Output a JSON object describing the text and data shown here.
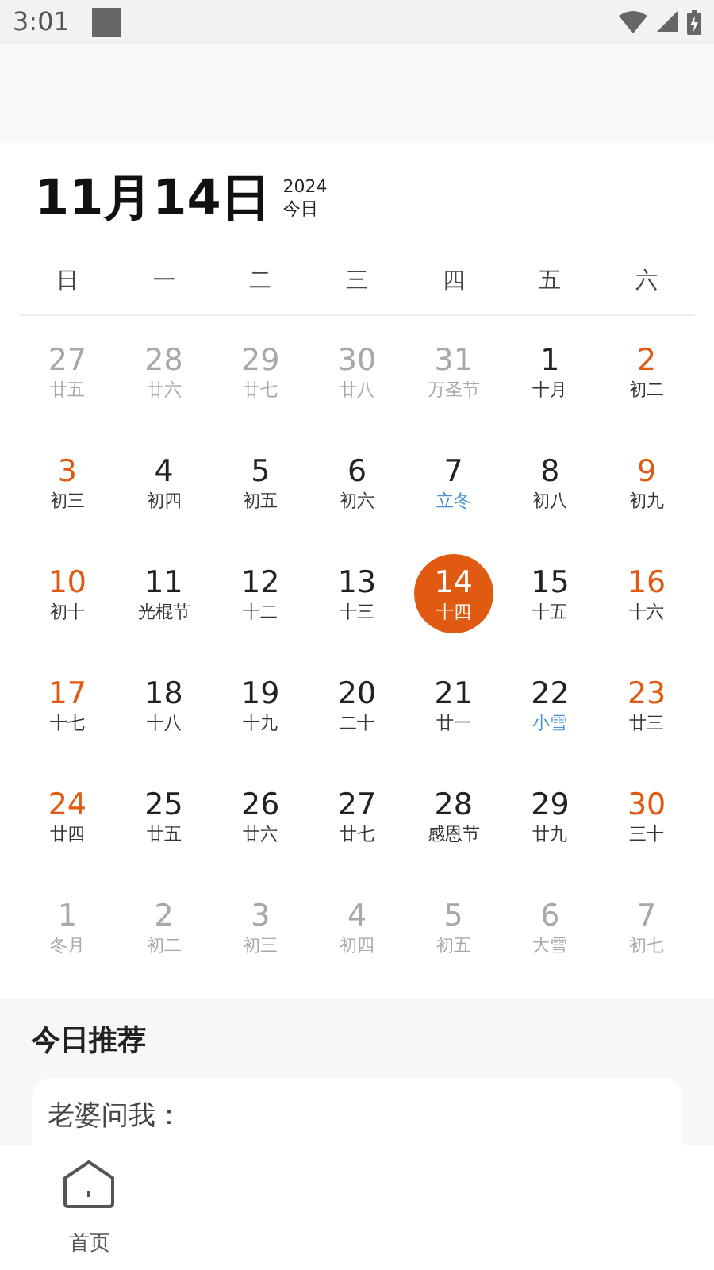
{
  "status_bar": {
    "time": "3:01"
  },
  "header": {
    "date": "11月14日",
    "year": "2024",
    "today": "今日"
  },
  "weekdays": [
    "日",
    "一",
    "二",
    "三",
    "四",
    "五",
    "六"
  ],
  "weeks": [
    [
      {
        "day": "27",
        "lunar": "廿五",
        "in_month": false,
        "term": false,
        "selected": false
      },
      {
        "day": "28",
        "lunar": "廿六",
        "in_month": false,
        "term": false,
        "selected": false
      },
      {
        "day": "29",
        "lunar": "廿七",
        "in_month": false,
        "term": false,
        "selected": false
      },
      {
        "day": "30",
        "lunar": "廿八",
        "in_month": false,
        "term": false,
        "selected": false
      },
      {
        "day": "31",
        "lunar": "万圣节",
        "in_month": false,
        "term": false,
        "selected": false
      },
      {
        "day": "1",
        "lunar": "十月",
        "in_month": true,
        "term": false,
        "selected": false
      },
      {
        "day": "2",
        "lunar": "初二",
        "in_month": true,
        "term": false,
        "selected": false
      }
    ],
    [
      {
        "day": "3",
        "lunar": "初三",
        "in_month": true,
        "term": false,
        "selected": false
      },
      {
        "day": "4",
        "lunar": "初四",
        "in_month": true,
        "term": false,
        "selected": false
      },
      {
        "day": "5",
        "lunar": "初五",
        "in_month": true,
        "term": false,
        "selected": false
      },
      {
        "day": "6",
        "lunar": "初六",
        "in_month": true,
        "term": false,
        "selected": false
      },
      {
        "day": "7",
        "lunar": "立冬",
        "in_month": true,
        "term": true,
        "selected": false
      },
      {
        "day": "8",
        "lunar": "初八",
        "in_month": true,
        "term": false,
        "selected": false
      },
      {
        "day": "9",
        "lunar": "初九",
        "in_month": true,
        "term": false,
        "selected": false
      }
    ],
    [
      {
        "day": "10",
        "lunar": "初十",
        "in_month": true,
        "term": false,
        "selected": false
      },
      {
        "day": "11",
        "lunar": "光棍节",
        "in_month": true,
        "term": false,
        "selected": false
      },
      {
        "day": "12",
        "lunar": "十二",
        "in_month": true,
        "term": false,
        "selected": false
      },
      {
        "day": "13",
        "lunar": "十三",
        "in_month": true,
        "term": false,
        "selected": false
      },
      {
        "day": "14",
        "lunar": "十四",
        "in_month": true,
        "term": false,
        "selected": true
      },
      {
        "day": "15",
        "lunar": "十五",
        "in_month": true,
        "term": false,
        "selected": false
      },
      {
        "day": "16",
        "lunar": "十六",
        "in_month": true,
        "term": false,
        "selected": false
      }
    ],
    [
      {
        "day": "17",
        "lunar": "十七",
        "in_month": true,
        "term": false,
        "selected": false
      },
      {
        "day": "18",
        "lunar": "十八",
        "in_month": true,
        "term": false,
        "selected": false
      },
      {
        "day": "19",
        "lunar": "十九",
        "in_month": true,
        "term": false,
        "selected": false
      },
      {
        "day": "20",
        "lunar": "二十",
        "in_month": true,
        "term": false,
        "selected": false
      },
      {
        "day": "21",
        "lunar": "廿一",
        "in_month": true,
        "term": false,
        "selected": false
      },
      {
        "day": "22",
        "lunar": "小雪",
        "in_month": true,
        "term": true,
        "selected": false
      },
      {
        "day": "23",
        "lunar": "廿三",
        "in_month": true,
        "term": false,
        "selected": false
      }
    ],
    [
      {
        "day": "24",
        "lunar": "廿四",
        "in_month": true,
        "term": false,
        "selected": false
      },
      {
        "day": "25",
        "lunar": "廿五",
        "in_month": true,
        "term": false,
        "selected": false
      },
      {
        "day": "26",
        "lunar": "廿六",
        "in_month": true,
        "term": false,
        "selected": false
      },
      {
        "day": "27",
        "lunar": "廿七",
        "in_month": true,
        "term": false,
        "selected": false
      },
      {
        "day": "28",
        "lunar": "感恩节",
        "in_month": true,
        "term": false,
        "selected": false
      },
      {
        "day": "29",
        "lunar": "廿九",
        "in_month": true,
        "term": false,
        "selected": false
      },
      {
        "day": "30",
        "lunar": "三十",
        "in_month": true,
        "term": false,
        "selected": false
      }
    ],
    [
      {
        "day": "1",
        "lunar": "冬月",
        "in_month": false,
        "term": false,
        "selected": false
      },
      {
        "day": "2",
        "lunar": "初二",
        "in_month": false,
        "term": false,
        "selected": false
      },
      {
        "day": "3",
        "lunar": "初三",
        "in_month": false,
        "term": false,
        "selected": false
      },
      {
        "day": "4",
        "lunar": "初四",
        "in_month": false,
        "term": false,
        "selected": false
      },
      {
        "day": "5",
        "lunar": "初五",
        "in_month": false,
        "term": false,
        "selected": false
      },
      {
        "day": "6",
        "lunar": "大雪",
        "in_month": false,
        "term": false,
        "selected": false
      },
      {
        "day": "7",
        "lunar": "初七",
        "in_month": false,
        "term": false,
        "selected": false
      }
    ]
  ],
  "recommend": {
    "title": "今日推荐",
    "text": "老婆问我："
  },
  "nav": [
    {
      "label": "首页",
      "selected": false
    }
  ]
}
